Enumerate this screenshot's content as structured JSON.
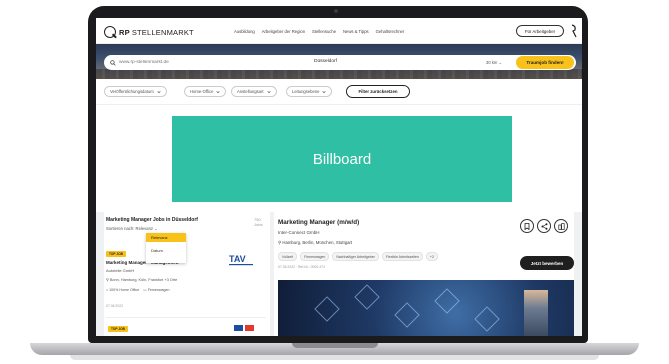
{
  "header": {
    "logo_bold": "RP",
    "logo_text": "STELLENMARKT",
    "nav": [
      "Ausbildung",
      "Arbeitgeber der Region",
      "Stellensuche",
      "News & Tipps",
      "Gehaltsrechner"
    ],
    "employer_button": "Für Arbeitgeber"
  },
  "search": {
    "keyword_placeholder": "www.rp-stellenmarkt.de",
    "location_value": "Düsseldorf",
    "radius_value": "30 km",
    "submit_label": "Traumjob finden!"
  },
  "filters": {
    "items": [
      "Veröffentlichungsdatum",
      "Home-Office",
      "Anstellungsart",
      "Leitungsebene"
    ],
    "reset_label": "Filter zurücksetzen"
  },
  "billboard": {
    "label": "Billboard"
  },
  "results": {
    "title": "Marketing Manager Jobs in Düsseldorf",
    "count": "750 Jobs",
    "sort_label": "Sortieren nach: Relevanz",
    "sort_options": [
      "Relevanz",
      "Datum"
    ],
    "cards": [
      {
        "badge": "TOP JOB",
        "title": "Marketing Manager - Management",
        "company": "Autoteile GmbH",
        "location": "Bonn, Hamburg, Köln, Frankfurt +3 Orte",
        "tags": [
          "100% Home Office",
          "Firmenwagen"
        ],
        "date": "07.06.2022",
        "logo_text": "TAV"
      },
      {
        "badge": "TOP JOB"
      }
    ]
  },
  "detail": {
    "title": "Marketing Manager (m/w/d)",
    "company": "Inter-Connect GmbH",
    "location": "Hamburg, Berlin, München, Stuttgart",
    "tags": [
      "Vollzeit",
      "Firmenwagen",
      "Nachhaltiger Arbeitgeber",
      "Flexible Arbeitszeiten",
      "+2"
    ],
    "meta": "07.06.2022 · Ref-Nr.: 0000-474",
    "apply_label": "Jetzt bewerben",
    "actions": [
      "bookmark-icon",
      "share-icon",
      "company-icon"
    ]
  },
  "colors": {
    "accent": "#f8c21a",
    "billboard": "#2fbfa5",
    "frame": "#1b1b1d"
  }
}
